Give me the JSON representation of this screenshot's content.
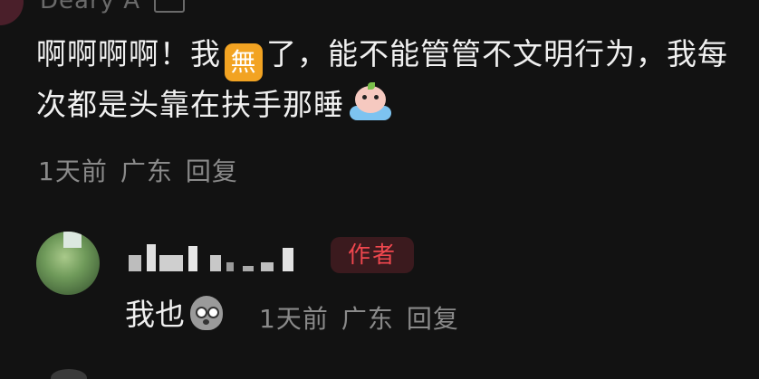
{
  "top_comment": {
    "username": "Deary A",
    "text_part1": "啊啊啊啊！我",
    "inline_emoji_1": "無",
    "text_part2": "了，能不能管管不文明行为，我每次都是头靠在扶手那睡",
    "inline_emoji_2_icon": "crying-emoji-icon",
    "time": "1天前",
    "location": "广东",
    "reply_label": "回复"
  },
  "reply_comment": {
    "username_hidden": true,
    "badge": "作者",
    "text": "我也",
    "inline_emoji_icon": "shocked-emoji-icon",
    "time": "1天前",
    "location": "广东",
    "reply_label": "回复"
  },
  "colors": {
    "background": "#121212",
    "text": "#f0f0f0",
    "meta": "#8a8a8a",
    "badge_bg": "#3b1a1e",
    "badge_text": "#f0474e",
    "emoji_box": "#f2a322"
  }
}
